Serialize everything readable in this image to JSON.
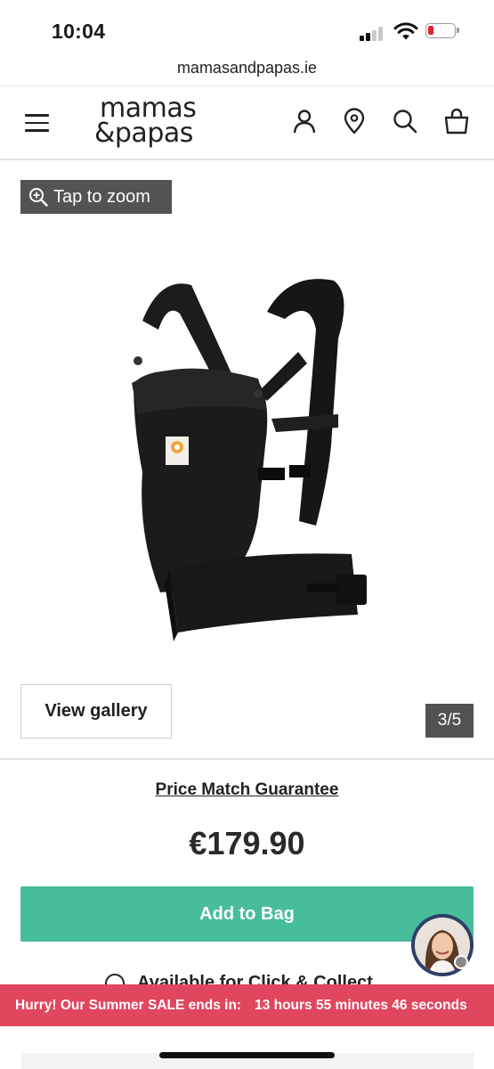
{
  "status_bar": {
    "time": "10:04"
  },
  "browser": {
    "url": "mamasandpapas.ie"
  },
  "header": {
    "logo_line1": "mamas",
    "logo_line2": "&papas",
    "icons": [
      "menu-icon",
      "account-icon",
      "store-locator-icon",
      "search-icon",
      "bag-icon"
    ]
  },
  "gallery": {
    "zoom_label": "Tap to zoom",
    "view_gallery_label": "View gallery",
    "counter": "3/5"
  },
  "product": {
    "price_match_label": "Price Match Guarantee",
    "price": "€179.90",
    "add_to_bag_label": "Add to Bag",
    "availability": "Available for Click & Collect"
  },
  "sale_banner": {
    "text": "Hurry! Our Summer SALE ends in:",
    "countdown": "13 hours 55 minutes 46 seconds"
  },
  "colors": {
    "accent_green": "#48bd9b",
    "banner_red": "#e1465f",
    "badge_grey": "#535353"
  }
}
